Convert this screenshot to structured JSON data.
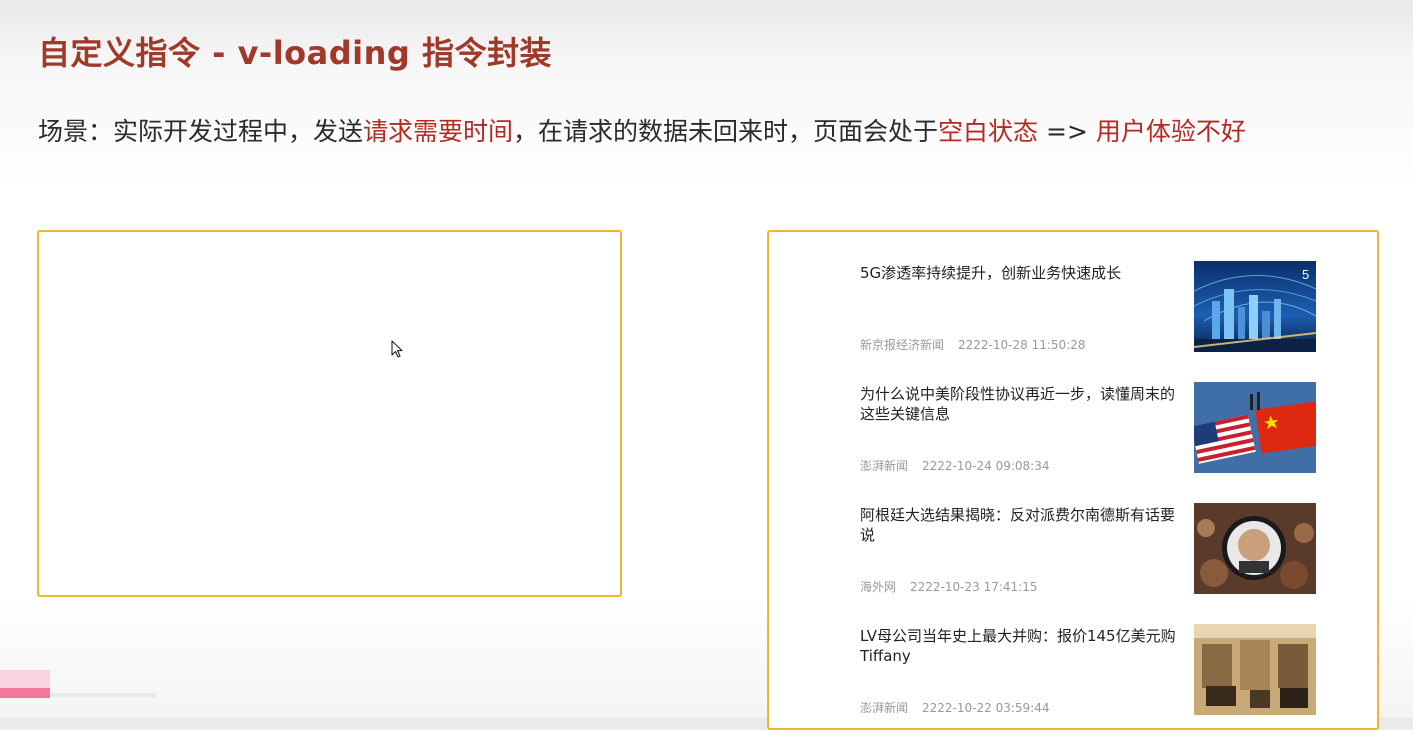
{
  "slide": {
    "title": "自定义指令 - v-loading 指令封装",
    "scene": {
      "prefix": "场景：实际开发过程中，发送",
      "highlight1": "请求需要时间",
      "middle": "，在请求的数据未回来时，页面会处于",
      "highlight2": "空白状态",
      "arrow": " => ",
      "highlight3": "用户体验不好"
    }
  },
  "news": [
    {
      "title": "5G渗透率持续提升，创新业务快速成长",
      "source": "新京报经济新闻",
      "time": "2222-10-28 11:50:28",
      "image": "5g-city-image"
    },
    {
      "title": "为什么说中美阶段性协议再近一步，读懂周末的这些关键信息",
      "source": "澎湃新闻",
      "time": "2222-10-24 09:08:34",
      "image": "us-china-flags-image"
    },
    {
      "title": "阿根廷大选结果揭晓：反对派费尔南德斯有话要说",
      "source": "海外网",
      "time": "2222-10-23 17:41:15",
      "image": "election-crowd-image"
    },
    {
      "title": "LV母公司当年史上最大并购：报价145亿美元购Tiffany",
      "source": "澎湃新闻",
      "time": "2222-10-22 03:59:44",
      "image": "store-interior-image"
    }
  ],
  "colors": {
    "title": "#a0392a",
    "highlight": "#b52a22",
    "panel_border": "#f2b52f",
    "progress": "#f2789b"
  },
  "icons": {
    "cursor": "mouse-pointer-icon"
  }
}
